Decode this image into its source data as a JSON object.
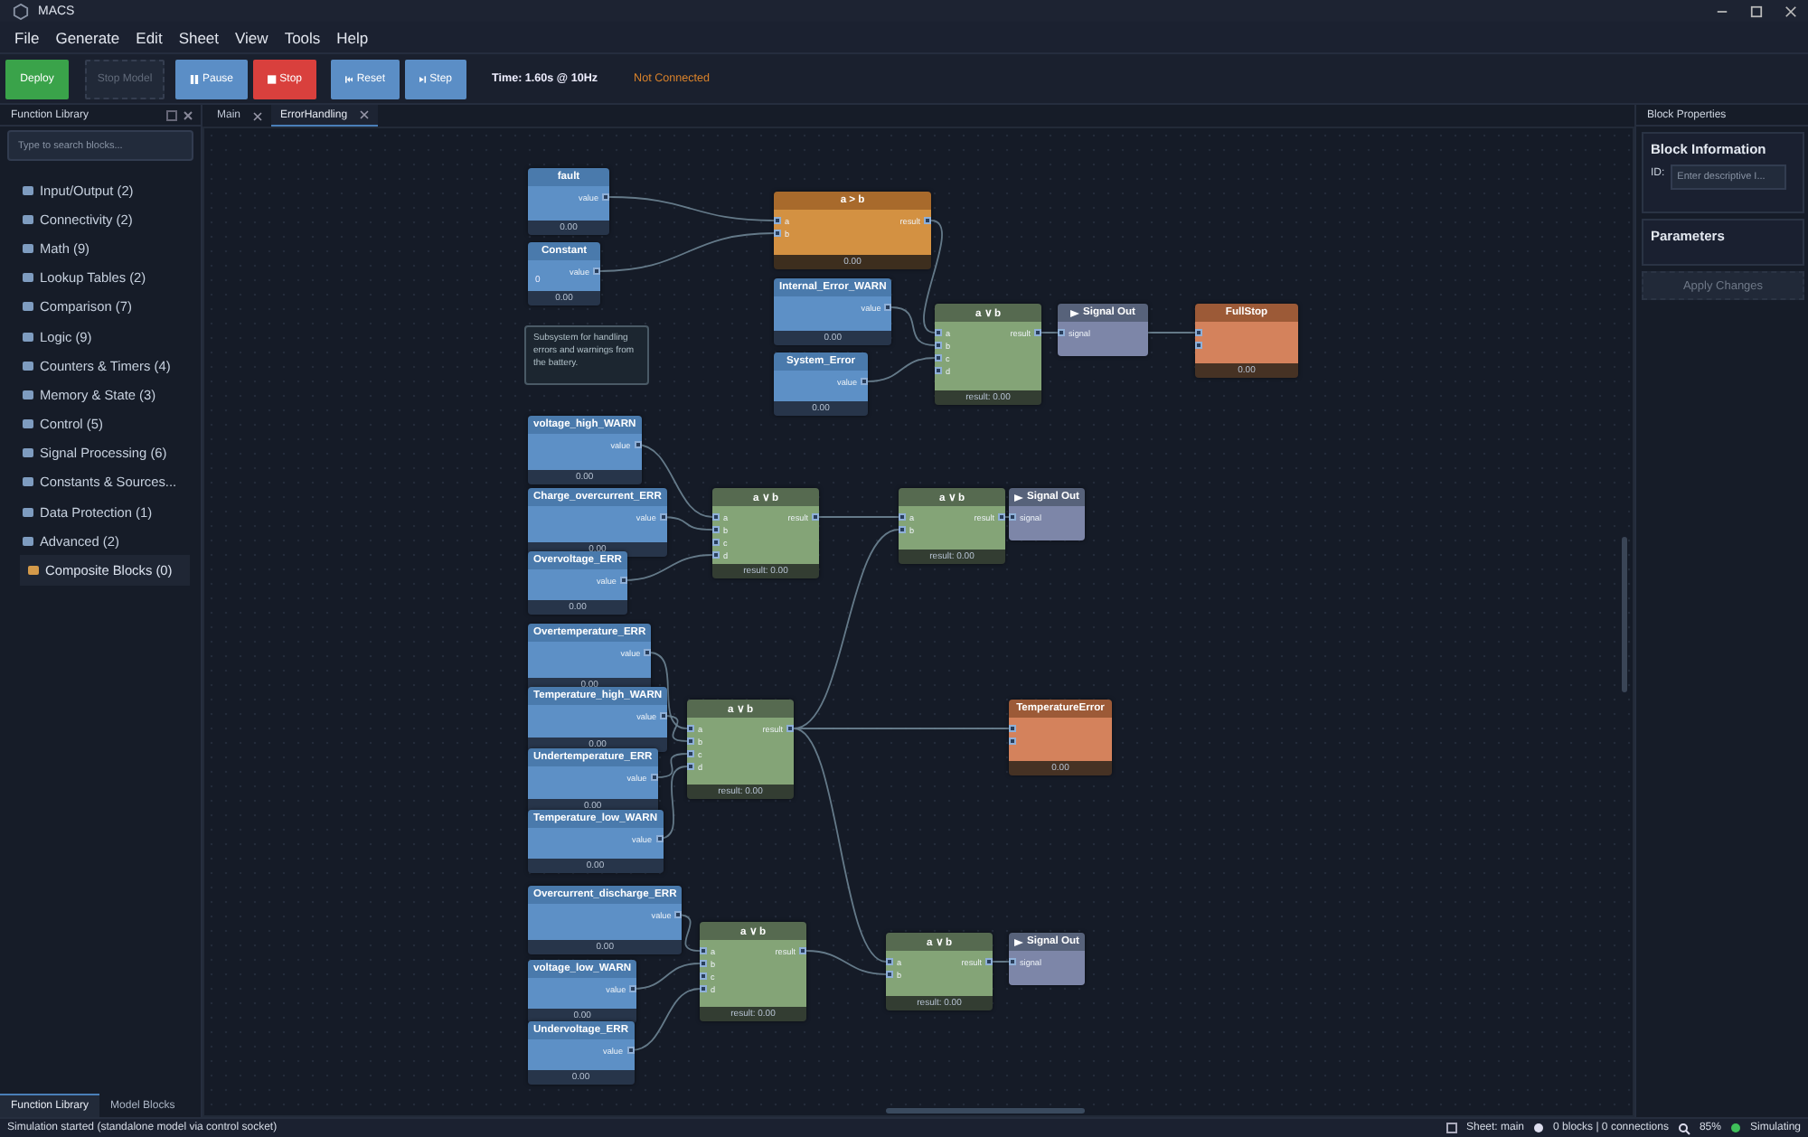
{
  "window": {
    "title": "MACS"
  },
  "menu": [
    "File",
    "Generate",
    "Edit",
    "Sheet",
    "View",
    "Tools",
    "Help"
  ],
  "toolbar": {
    "buttons": [
      {
        "label": "Deploy",
        "kind": "deploy",
        "disabled": false
      },
      {
        "label": "Stop Model",
        "kind": "plain",
        "disabled": true
      },
      {
        "label": "Pause",
        "kind": "pause",
        "disabled": false
      },
      {
        "label": "Stop",
        "kind": "stop",
        "disabled": false
      },
      {
        "label": "Reset",
        "kind": "reset",
        "disabled": false
      },
      {
        "label": "Step",
        "kind": "step",
        "disabled": false
      }
    ],
    "time": "Time: 1.60s @ 10Hz",
    "connection": "Not Connected"
  },
  "library": {
    "title": "Function Library",
    "search": {
      "placeholder": "Type to search blocks..."
    },
    "categories": [
      {
        "label": "Input/Output (2)",
        "selected": false
      },
      {
        "label": "Connectivity (2)",
        "selected": false
      },
      {
        "label": "Math (9)",
        "selected": false
      },
      {
        "label": "Lookup Tables (2)",
        "selected": false
      },
      {
        "label": "Comparison (7)",
        "selected": false
      },
      {
        "label": "Logic (9)",
        "selected": false
      },
      {
        "label": "Counters & Timers (4)",
        "selected": false
      },
      {
        "label": "Memory & State (3)",
        "selected": false
      },
      {
        "label": "Control (5)",
        "selected": false
      },
      {
        "label": "Signal Processing (6)",
        "selected": false
      },
      {
        "label": "Constants & Sources...",
        "selected": false
      },
      {
        "label": "Data Protection (1)",
        "selected": false
      },
      {
        "label": "Advanced (2)",
        "selected": false
      },
      {
        "label": "Composite Blocks (0)",
        "selected": true
      }
    ],
    "tabs": [
      {
        "label": "Function Library",
        "selected": true
      },
      {
        "label": "Model Blocks",
        "selected": false
      }
    ]
  },
  "tabs": [
    {
      "label": "Main",
      "selected": false
    },
    {
      "label": "ErrorHandling",
      "selected": true
    }
  ],
  "nodes": [
    {
      "kind": "input",
      "title": "fault",
      "outputs": [
        "value"
      ],
      "footer": "0.00"
    },
    {
      "kind": "input",
      "title": "Constant",
      "outputs": [
        "value"
      ],
      "text": "0",
      "footer": "0.00"
    },
    {
      "kind": "compare",
      "title": "a > b",
      "inputs": [
        "a",
        "b"
      ],
      "outputs": [
        "result"
      ],
      "footer": "0.00"
    },
    {
      "kind": "input",
      "title": "Internal_Error_WARN",
      "outputs": [
        "value"
      ],
      "footer": "0.00"
    },
    {
      "kind": "input",
      "title": "System_Error",
      "outputs": [
        "value"
      ],
      "footer": "0.00"
    },
    {
      "kind": "logic",
      "title": "a ∨ b",
      "inputs": [
        "a",
        "b",
        "c",
        "d"
      ],
      "outputs": [
        "result"
      ],
      "footer": "result: 0.00"
    },
    {
      "kind": "output",
      "title": "Signal Out",
      "inputs": [
        "signal"
      ]
    },
    {
      "kind": "alarm",
      "title": "FullStop",
      "footer": "0.00"
    },
    {
      "kind": "comment",
      "text": "Subsystem for handling errors and warnings from the battery."
    },
    {
      "kind": "input",
      "title": "voltage_high_WARN",
      "outputs": [
        "value"
      ],
      "footer": "0.00"
    },
    {
      "kind": "input",
      "title": "Charge_overcurrent_ERR",
      "outputs": [
        "value"
      ],
      "footer": "0.00"
    },
    {
      "kind": "input",
      "title": "Overvoltage_ERR",
      "outputs": [
        "value"
      ],
      "footer": "0.00"
    },
    {
      "kind": "logic",
      "title": "a ∨ b",
      "inputs": [
        "a",
        "b",
        "c",
        "d"
      ],
      "outputs": [
        "result"
      ],
      "footer": "result: 0.00"
    },
    {
      "kind": "logic",
      "title": "a ∨ b",
      "inputs": [
        "a",
        "b"
      ],
      "outputs": [
        "result"
      ],
      "footer": "result: 0.00"
    },
    {
      "kind": "output",
      "title": "Signal Out",
      "inputs": [
        "signal"
      ]
    },
    {
      "kind": "input",
      "title": "Overtemperature_ERR",
      "outputs": [
        "value"
      ],
      "footer": "0.00"
    },
    {
      "kind": "input",
      "title": "Temperature_high_WARN",
      "outputs": [
        "value"
      ],
      "footer": "0.00"
    },
    {
      "kind": "input",
      "title": "Undertemperature_ERR",
      "outputs": [
        "value"
      ],
      "footer": "0.00"
    },
    {
      "kind": "input",
      "title": "Temperature_low_WARN",
      "outputs": [
        "value"
      ],
      "footer": "0.00"
    },
    {
      "kind": "logic",
      "title": "a ∨ b",
      "inputs": [
        "a",
        "b",
        "c",
        "d"
      ],
      "outputs": [
        "result"
      ],
      "footer": "result: 0.00"
    },
    {
      "kind": "alarm",
      "title": "TemperatureError",
      "footer": "0.00"
    },
    {
      "kind": "input",
      "title": "Overcurrent_discharge_ERR",
      "outputs": [
        "value"
      ],
      "footer": "0.00"
    },
    {
      "kind": "input",
      "title": "voltage_low_WARN",
      "outputs": [
        "value"
      ],
      "footer": "0.00"
    },
    {
      "kind": "input",
      "title": "Undervoltage_ERR",
      "outputs": [
        "value"
      ],
      "footer": "0.00"
    },
    {
      "kind": "logic",
      "title": "a ∨ b",
      "inputs": [
        "a",
        "b",
        "c",
        "d"
      ],
      "outputs": [
        "result"
      ],
      "footer": "result: 0.00"
    },
    {
      "kind": "logic",
      "title": "a ∨ b",
      "inputs": [
        "a",
        "b"
      ],
      "outputs": [
        "result"
      ],
      "footer": "result: 0.00"
    },
    {
      "kind": "output",
      "title": "Signal Out",
      "inputs": [
        "signal"
      ]
    }
  ],
  "properties": {
    "title": "Block Properties",
    "info_title": "Block Information",
    "id_label": "ID:",
    "id_placeholder": "Enter descriptive I...",
    "params_title": "Parameters",
    "apply": {
      "label": "Apply Changes",
      "disabled": true
    }
  },
  "status_bar": {
    "message": "Simulation started (standalone model via control socket)",
    "sheet": "Sheet: main",
    "counts": "0 blocks | 0 connections",
    "zoom": "85%",
    "state": "Simulating"
  }
}
